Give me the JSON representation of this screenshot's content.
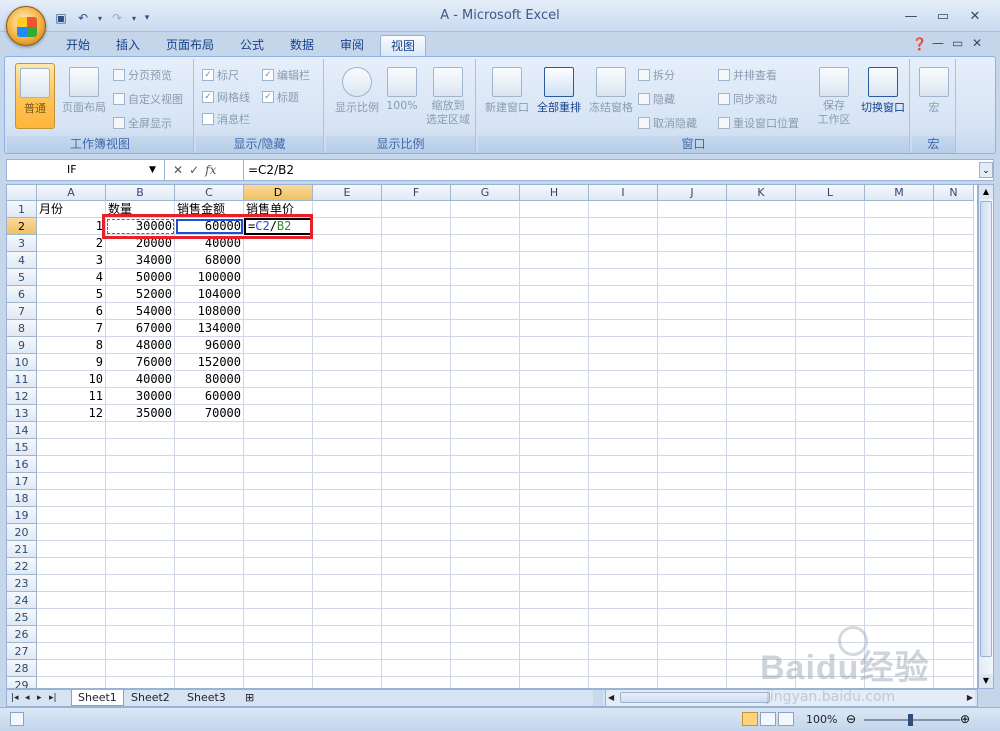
{
  "window": {
    "title": "A - Microsoft Excel"
  },
  "tabs": [
    "开始",
    "插入",
    "页面布局",
    "公式",
    "数据",
    "审阅",
    "视图"
  ],
  "active_tab": "视图",
  "ribbon": {
    "workbook_views": {
      "title": "工作簿视图",
      "normal": "普通",
      "page_layout": "页面布局",
      "page_break": "分页预览",
      "custom_views": "自定义视图",
      "full_screen": "全屏显示"
    },
    "show_hide": {
      "title": "显示/隐藏",
      "ruler": "标尺",
      "formula_bar": "编辑栏",
      "gridlines": "网格线",
      "headings": "标题",
      "message_bar": "消息栏"
    },
    "zoom": {
      "title": "显示比例",
      "zoom": "显示比例",
      "hundred": "100%",
      "zoom_sel_1": "缩放到",
      "zoom_sel_2": "选定区域"
    },
    "window": {
      "title": "窗口",
      "new_window": "新建窗口",
      "arrange_all": "全部重排",
      "freeze": "冻结窗格",
      "split": "拆分",
      "hide": "隐藏",
      "unhide": "取消隐藏",
      "side_by_side": "并排查看",
      "sync_scroll": "同步滚动",
      "reset_pos": "重设窗口位置",
      "save_ws_1": "保存",
      "save_ws_2": "工作区",
      "switch": "切换窗口"
    },
    "macros": {
      "title": "宏",
      "macro": "宏"
    }
  },
  "formula_bar": {
    "name_box": "IF",
    "cancel": "✕",
    "enter": "✓",
    "fx": "fx",
    "formula": "=C2/B2"
  },
  "columns": [
    "A",
    "B",
    "C",
    "D",
    "E",
    "F",
    "G",
    "H",
    "I",
    "J",
    "K",
    "L",
    "M",
    "N"
  ],
  "headers": [
    "月份",
    "数量",
    "销售金额",
    "销售单价"
  ],
  "rows": [
    [
      "1",
      "30000",
      "60000"
    ],
    [
      "2",
      "20000",
      "40000"
    ],
    [
      "3",
      "34000",
      "68000"
    ],
    [
      "4",
      "50000",
      "100000"
    ],
    [
      "5",
      "52000",
      "104000"
    ],
    [
      "6",
      "54000",
      "108000"
    ],
    [
      "7",
      "67000",
      "134000"
    ],
    [
      "8",
      "48000",
      "96000"
    ],
    [
      "9",
      "76000",
      "152000"
    ],
    [
      "10",
      "40000",
      "80000"
    ],
    [
      "11",
      "30000",
      "60000"
    ],
    [
      "12",
      "35000",
      "70000"
    ]
  ],
  "active_cell_text": {
    "prefix": "=",
    "ref1": "C2",
    "slash": "/",
    "ref2": "B2"
  },
  "row_numbers": [
    "1",
    "2",
    "3",
    "4",
    "5",
    "6",
    "7",
    "8",
    "9",
    "10",
    "11",
    "12",
    "13",
    "14",
    "15",
    "16",
    "17",
    "18",
    "19",
    "20",
    "21",
    "22",
    "23",
    "24",
    "25",
    "26",
    "27",
    "28",
    "29"
  ],
  "sheet_tabs": [
    "Sheet1",
    "Sheet2",
    "Sheet3"
  ],
  "status": {
    "zoom": "100%"
  },
  "watermark": {
    "brand": "Baidu经验",
    "url": "jingyan.baidu.com"
  },
  "colors": {
    "accent": "#15428b",
    "highlight": "#e8202a",
    "ref_blue": "#1f4fd6",
    "ref_green": "#2e8b2e"
  }
}
